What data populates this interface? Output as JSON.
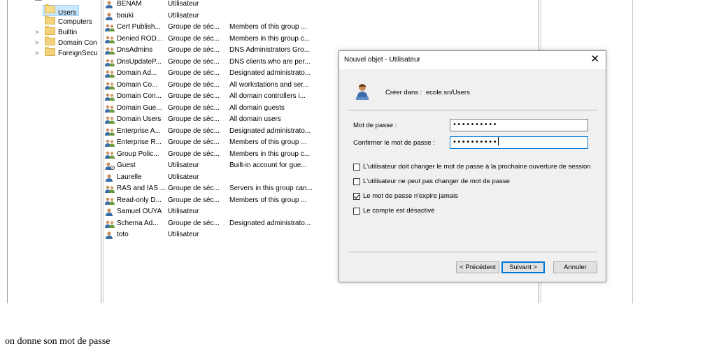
{
  "tree": {
    "items": [
      {
        "label": "Users",
        "selected": true,
        "expander": ""
      },
      {
        "label": "Computers",
        "expander": ""
      },
      {
        "label": "Builtin",
        "expander": ">"
      },
      {
        "label": "Domain Con",
        "expander": ">"
      },
      {
        "label": "ForeignSecu",
        "expander": ">"
      }
    ]
  },
  "objects": [
    {
      "name": "BENAM",
      "type": "Utilisateur",
      "desc": "",
      "icon": "user-icon"
    },
    {
      "name": "bouki",
      "type": "Utilisateur",
      "desc": "",
      "icon": "user-icon"
    },
    {
      "name": "Cert Publish...",
      "type": "Groupe de séc...",
      "desc": "Members of this group ...",
      "icon": "group-icon"
    },
    {
      "name": "Denied ROD...",
      "type": "Groupe de séc...",
      "desc": "Members in this group c...",
      "icon": "group-icon"
    },
    {
      "name": "DnsAdmins",
      "type": "Groupe de séc...",
      "desc": "DNS Administrators Gro...",
      "icon": "group-icon"
    },
    {
      "name": "DnsUpdateP...",
      "type": "Groupe de séc...",
      "desc": "DNS clients who are per...",
      "icon": "group-icon"
    },
    {
      "name": "Domain Ad...",
      "type": "Groupe de séc...",
      "desc": "Designated administrato...",
      "icon": "group-icon"
    },
    {
      "name": "Domain Co...",
      "type": "Groupe de séc...",
      "desc": "All workstations and ser...",
      "icon": "group-icon"
    },
    {
      "name": "Domain Con...",
      "type": "Groupe de séc...",
      "desc": "All domain controllers i...",
      "icon": "group-icon"
    },
    {
      "name": "Domain Gue...",
      "type": "Groupe de séc...",
      "desc": "All domain guests",
      "icon": "group-icon"
    },
    {
      "name": "Domain Users",
      "type": "Groupe de séc...",
      "desc": "All domain users",
      "icon": "group-icon"
    },
    {
      "name": "Enterprise A...",
      "type": "Groupe de séc...",
      "desc": "Designated administrato...",
      "icon": "group-icon"
    },
    {
      "name": "Enterprise R...",
      "type": "Groupe de séc...",
      "desc": "Members of this group ...",
      "icon": "group-icon"
    },
    {
      "name": "Group Polic...",
      "type": "Groupe de séc...",
      "desc": "Members in this group c...",
      "icon": "group-icon"
    },
    {
      "name": "Guest",
      "type": "Utilisateur",
      "desc": "Built-in account for gue...",
      "icon": "user-disabled-icon"
    },
    {
      "name": "Laurelle",
      "type": "Utilisateur",
      "desc": "",
      "icon": "user-icon"
    },
    {
      "name": "RAS and IAS ...",
      "type": "Groupe de séc...",
      "desc": "Servers in this group can...",
      "icon": "group-icon"
    },
    {
      "name": "Read-only D...",
      "type": "Groupe de séc...",
      "desc": "Members of this group ...",
      "icon": "group-icon"
    },
    {
      "name": "Samuel OUYA",
      "type": "Utilisateur",
      "desc": "",
      "icon": "user-icon"
    },
    {
      "name": "Schema Ad...",
      "type": "Groupe de séc...",
      "desc": "Designated administrato...",
      "icon": "group-icon"
    },
    {
      "name": "toto",
      "type": "Utilisateur",
      "desc": "",
      "icon": "user-icon"
    }
  ],
  "dialog": {
    "title": "Nouvel objet - Utilisateur",
    "close_glyph": "✕",
    "create_in_label": "Créer dans :",
    "create_in_value": "ecole.sn/Users",
    "password_label": "Mot de passe :",
    "password_value": "••••••••••",
    "confirm_label": "Confirmer le mot de passe :",
    "confirm_value": "••••••••••",
    "options": [
      {
        "label": "L'utilisateur doit changer le mot de passe à la prochaine ouverture de session",
        "checked": false
      },
      {
        "label": "L'utilisateur ne peut pas changer de mot de passe",
        "checked": false
      },
      {
        "label": "Le mot de passe n'expire jamais",
        "checked": true
      },
      {
        "label": "Le compte est désactivé",
        "checked": false
      }
    ],
    "buttons": {
      "previous": "< Précédent",
      "next": "Suivant >",
      "cancel": "Annuler"
    }
  },
  "caption": "on donne son mot de passe"
}
